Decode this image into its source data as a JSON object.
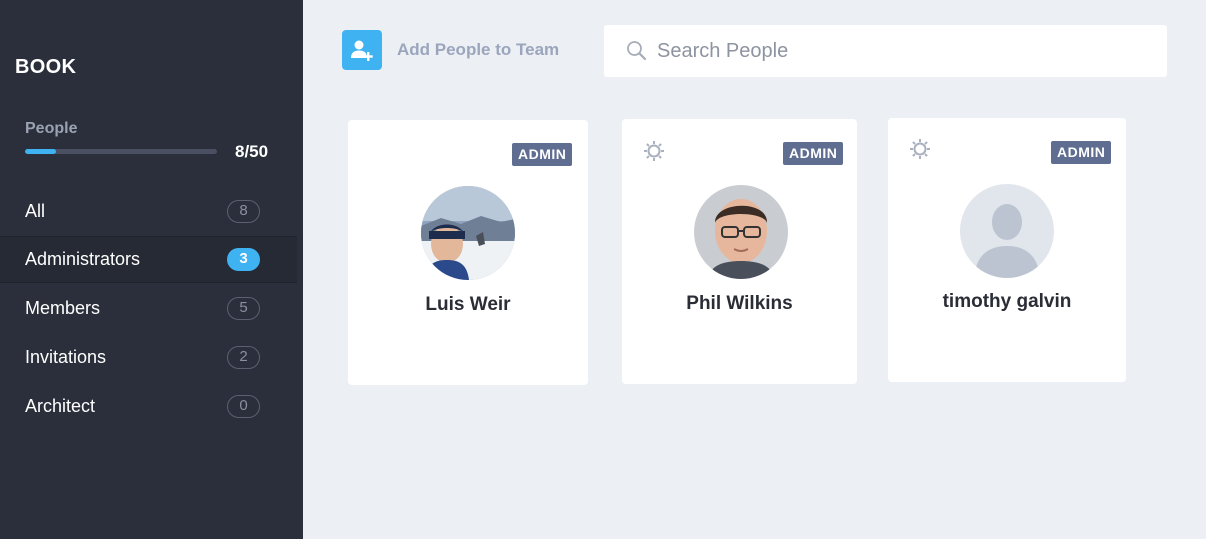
{
  "sidebar": {
    "brand": "BOOK",
    "people_label": "People",
    "people_count": "8/50",
    "people_progress": 0.16,
    "items": [
      {
        "label": "All",
        "count": "8",
        "active": false
      },
      {
        "label": "Administrators",
        "count": "3",
        "active": true
      },
      {
        "label": "Members",
        "count": "5",
        "active": false
      },
      {
        "label": "Invitations",
        "count": "2",
        "active": false
      },
      {
        "label": "Architect",
        "count": "0",
        "active": false
      }
    ]
  },
  "toolbar": {
    "add_label": "Add People to Team",
    "add_icon": "add-person-icon",
    "search_placeholder": "Search People",
    "search_value": "",
    "search_icon": "search-icon"
  },
  "cards": [
    {
      "name": "Luis Weir",
      "badge": "ADMIN",
      "has_settings": false,
      "avatar": "photo"
    },
    {
      "name": "Phil Wilkins",
      "badge": "ADMIN",
      "has_settings": true,
      "avatar": "photo"
    },
    {
      "name": "timothy galvin",
      "badge": "ADMIN",
      "has_settings": true,
      "avatar": "placeholder"
    }
  ],
  "colors": {
    "sidebar_bg": "#2b2f3b",
    "accent": "#3fb2f2",
    "content_bg": "#eceff4",
    "badge_bg": "#5f6e90"
  }
}
